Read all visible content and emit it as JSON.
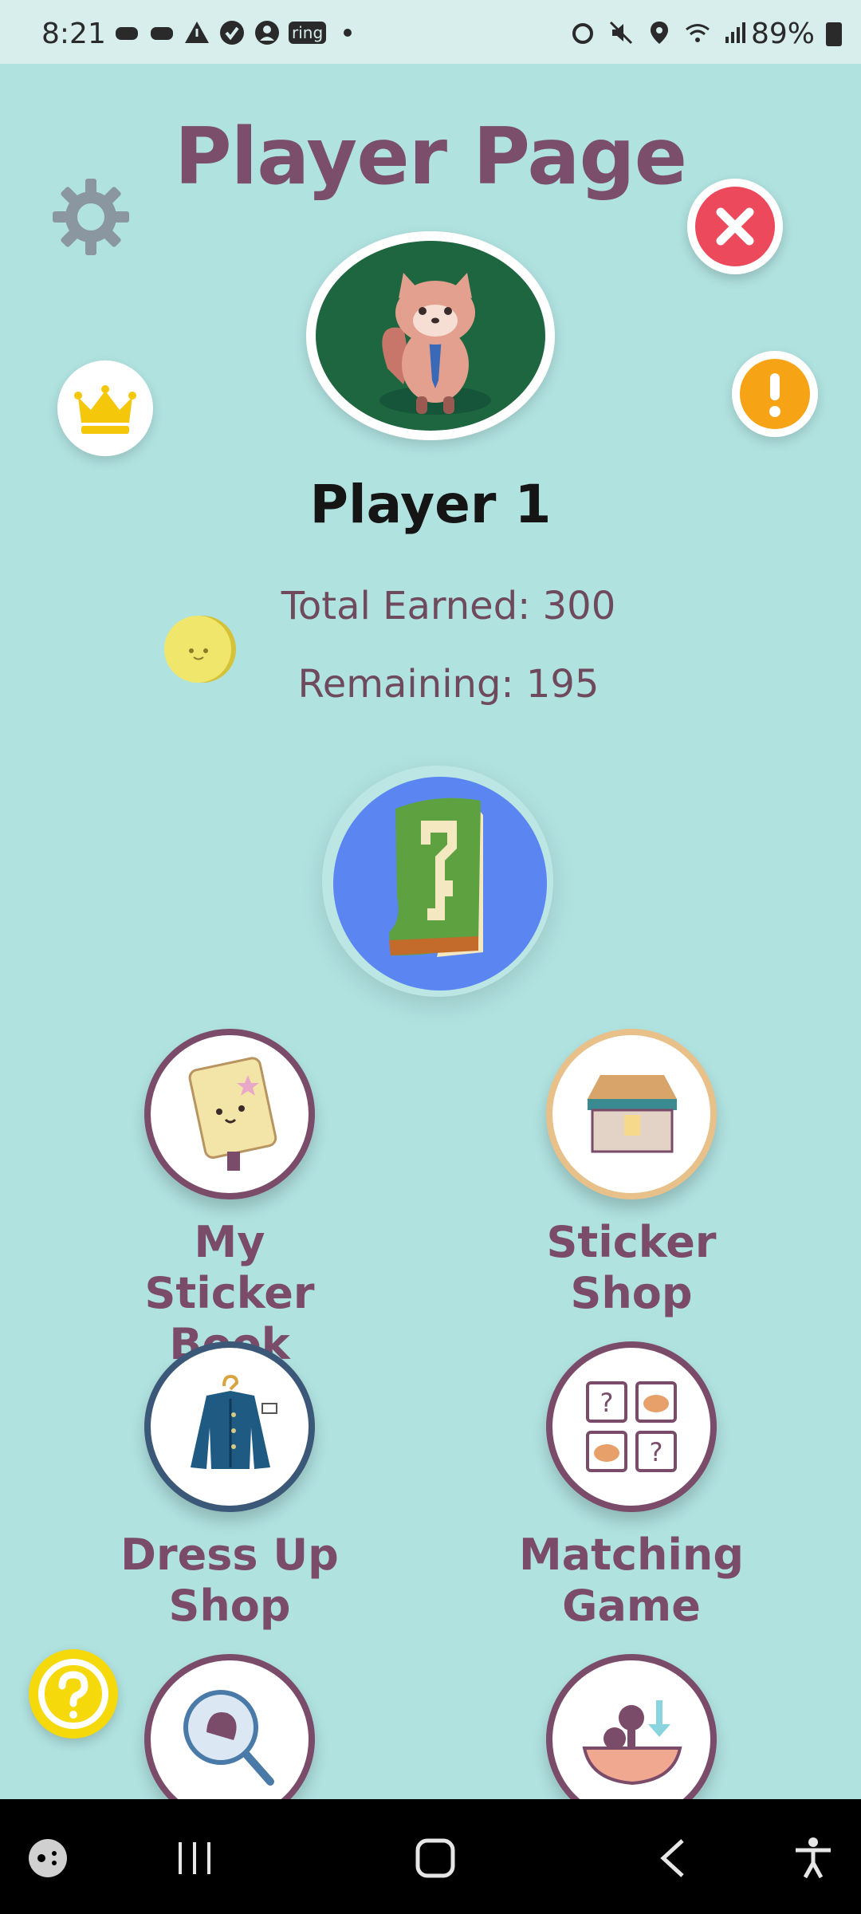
{
  "status_bar": {
    "time": "8:21",
    "battery": "89%",
    "ring_label": "ring"
  },
  "page": {
    "title": "Player Page",
    "player_name": "Player 1",
    "total_earned": "Total Earned: 300",
    "remaining": "Remaining: 195"
  },
  "tiles": [
    {
      "label": "My Sticker\nBook",
      "icon": "sticker-book-icon",
      "border": "#7a4c6a"
    },
    {
      "label": "Sticker\nShop",
      "icon": "shop-icon",
      "border": "#e8c08a"
    },
    {
      "label": "Dress Up\nShop",
      "icon": "jacket-icon",
      "border": "#3c5878"
    },
    {
      "label": "Matching\nGame",
      "icon": "matching-cards-icon",
      "border": "#7a4c6a"
    },
    {
      "label": "",
      "icon": "magnifier-icon",
      "border": "#7a4c6a"
    },
    {
      "label": "",
      "icon": "food-bowl-icon",
      "border": "#7a4c6a"
    }
  ],
  "colors": {
    "background": "#b0e2e0",
    "accent": "#7b4e6c",
    "close": "#ec4a5c",
    "alert": "#f7a316",
    "help": "#f5d90a",
    "feature": "#5b86f2"
  },
  "icons": {
    "settings": "gear-icon",
    "close": "close-icon",
    "crown": "crown-icon",
    "alert": "alert-icon",
    "coin": "coin-icon",
    "help": "help-icon",
    "featured": "mystery-boot-icon"
  }
}
